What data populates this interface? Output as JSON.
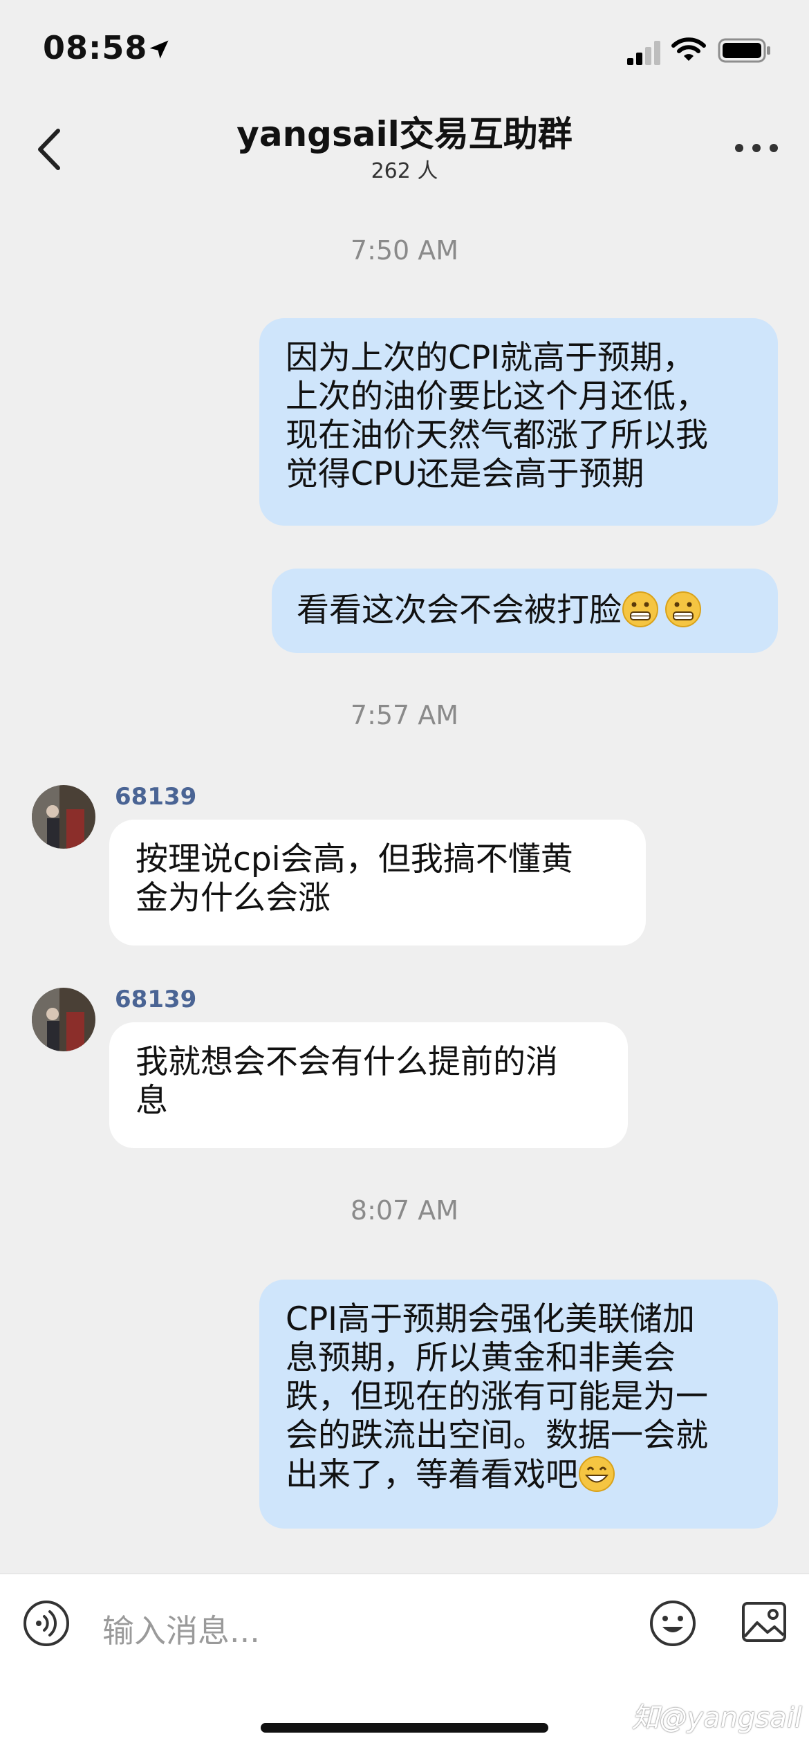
{
  "status_bar": {
    "time": "08:58"
  },
  "header": {
    "title": "yangsail交易互助群",
    "members": "262 人"
  },
  "messages": {
    "ts1": "7:50 AM",
    "m1": "因为上次的CPI就高于预期，\n上次的油价要比这个月还低，\n现在油价天然气都涨了所以我\n觉得CPU还是会高于预期",
    "m2": "看看这次会不会被打脸",
    "ts2": "7:57 AM",
    "sender1": "68139",
    "m3": "按理说cpi会高，但我搞不懂黄\n金为什么会涨",
    "sender2": "68139",
    "m4": "我就想会不会有什么提前的消\n息",
    "ts3": "8:07 AM",
    "m5": "CPI高于预期会强化美联储加\n息预期，所以黄金和非美会\n跌，但现在的涨有可能是为一\n会的跌流出空间。数据一会就\n出来了，等着看戏吧"
  },
  "input": {
    "placeholder": "输入消息..."
  },
  "watermark": "知@yangsail",
  "colors": {
    "outgoing_bubble": "#cfe5fb",
    "incoming_bubble": "#ffffff",
    "background": "#efefef",
    "sender_name": "#4a6494"
  },
  "icons": [
    "location-arrow-icon",
    "signal-icon",
    "wifi-icon",
    "battery-icon",
    "back-chevron-icon",
    "more-icon",
    "voice-icon",
    "emoji-icon",
    "image-icon",
    "grimace-emoji-icon",
    "grin-emoji-icon"
  ]
}
